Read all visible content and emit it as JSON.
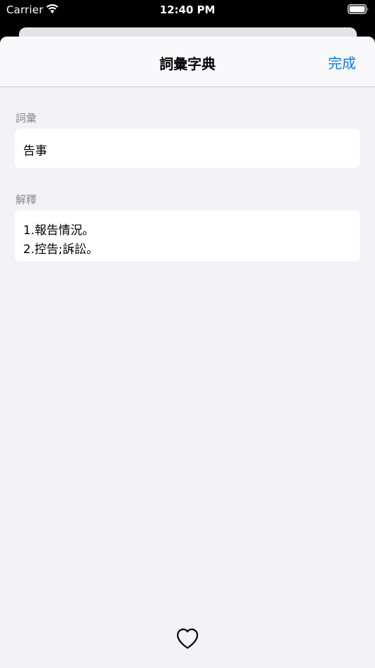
{
  "status_bar": {
    "carrier": "Carrier",
    "time": "12:40 PM"
  },
  "nav": {
    "title": "詞彙字典",
    "done_label": "完成"
  },
  "term_section": {
    "label": "詞彙",
    "value": "告事"
  },
  "definition_section": {
    "label": "解釋",
    "lines": [
      "1.報告情況。",
      "2.控告;訴訟。"
    ]
  },
  "colors": {
    "accent": "#0a7aff",
    "background": "#f2f2f7",
    "secondary_text": "#8a8a8e"
  },
  "icons": {
    "status": [
      "wifi-icon",
      "battery-icon"
    ],
    "toolbar": "heart-icon"
  }
}
